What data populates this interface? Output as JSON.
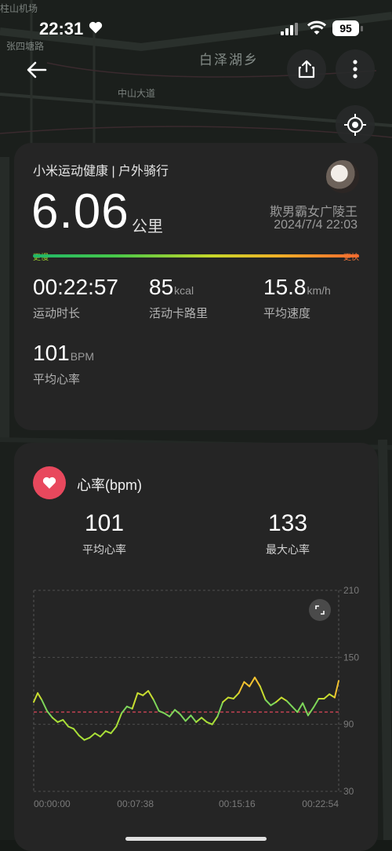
{
  "status_bar": {
    "time": "22:31",
    "battery": "95"
  },
  "map": {
    "labels": {
      "airport": "柱山机场",
      "village": "张四塘路",
      "lake": "白泽湖乡",
      "road": "中山大道"
    }
  },
  "summary": {
    "source": "小米运动健康 | 户外骑行",
    "distance": "6.06",
    "distance_unit": "公里",
    "username": "欺男霸女广陵王",
    "datetime": "2024/7/4 22:03",
    "scale_slow": "更慢",
    "scale_fast": "更快",
    "stats": [
      {
        "value": "00:22:57",
        "unit": "",
        "label": "运动时长"
      },
      {
        "value": "85",
        "unit": "kcal",
        "label": "活动卡路里"
      },
      {
        "value": "15.8",
        "unit": "km/h",
        "label": "平均速度"
      },
      {
        "value": "101",
        "unit": "BPM",
        "label": "平均心率"
      }
    ]
  },
  "heart_rate": {
    "title": "心率(bpm)",
    "avg_value": "101",
    "avg_label": "平均心率",
    "max_value": "133",
    "max_label": "最大心率"
  },
  "chart_data": {
    "type": "line",
    "title": "",
    "xlabel": "",
    "ylabel": "",
    "y_ticks": [
      210,
      150,
      90,
      30
    ],
    "x_ticks": [
      "00:00:00",
      "00:07:38",
      "00:15:16",
      "00:22:54"
    ],
    "ylim": [
      30,
      210
    ],
    "xlim_minutes": [
      0,
      22.9
    ],
    "average_line": 101,
    "grid": "dashed horizontal at 150 and 90",
    "series": [
      {
        "x_minutes": [
          0,
          0.3,
          0.6,
          1.0,
          1.4,
          1.8,
          2.2,
          2.6,
          3.0,
          3.4,
          3.8,
          4.2,
          4.6,
          5.0,
          5.4,
          5.8,
          6.2,
          6.6,
          7.0,
          7.4,
          7.8,
          8.2,
          8.6,
          9.0,
          9.4,
          9.8,
          10.2,
          10.6,
          11.0,
          11.4,
          11.8,
          12.2,
          12.6,
          13.0,
          13.4,
          13.8,
          14.2,
          14.6,
          15.0,
          15.4,
          15.8,
          16.2,
          16.6,
          17.0,
          17.4,
          17.8,
          18.2,
          18.6,
          19.0,
          19.4,
          19.8,
          20.2,
          20.6,
          21.0,
          21.4,
          21.8,
          22.2,
          22.6,
          22.9
        ],
        "values": [
          110,
          118,
          112,
          102,
          96,
          92,
          94,
          88,
          86,
          80,
          76,
          78,
          82,
          79,
          84,
          82,
          88,
          100,
          106,
          104,
          118,
          116,
          120,
          112,
          102,
          100,
          97,
          103,
          99,
          93,
          98,
          92,
          96,
          92,
          90,
          97,
          110,
          114,
          113,
          118,
          128,
          124,
          132,
          124,
          112,
          107,
          110,
          114,
          111,
          106,
          101,
          109,
          98,
          105,
          113,
          113,
          117,
          114,
          129
        ]
      }
    ]
  }
}
